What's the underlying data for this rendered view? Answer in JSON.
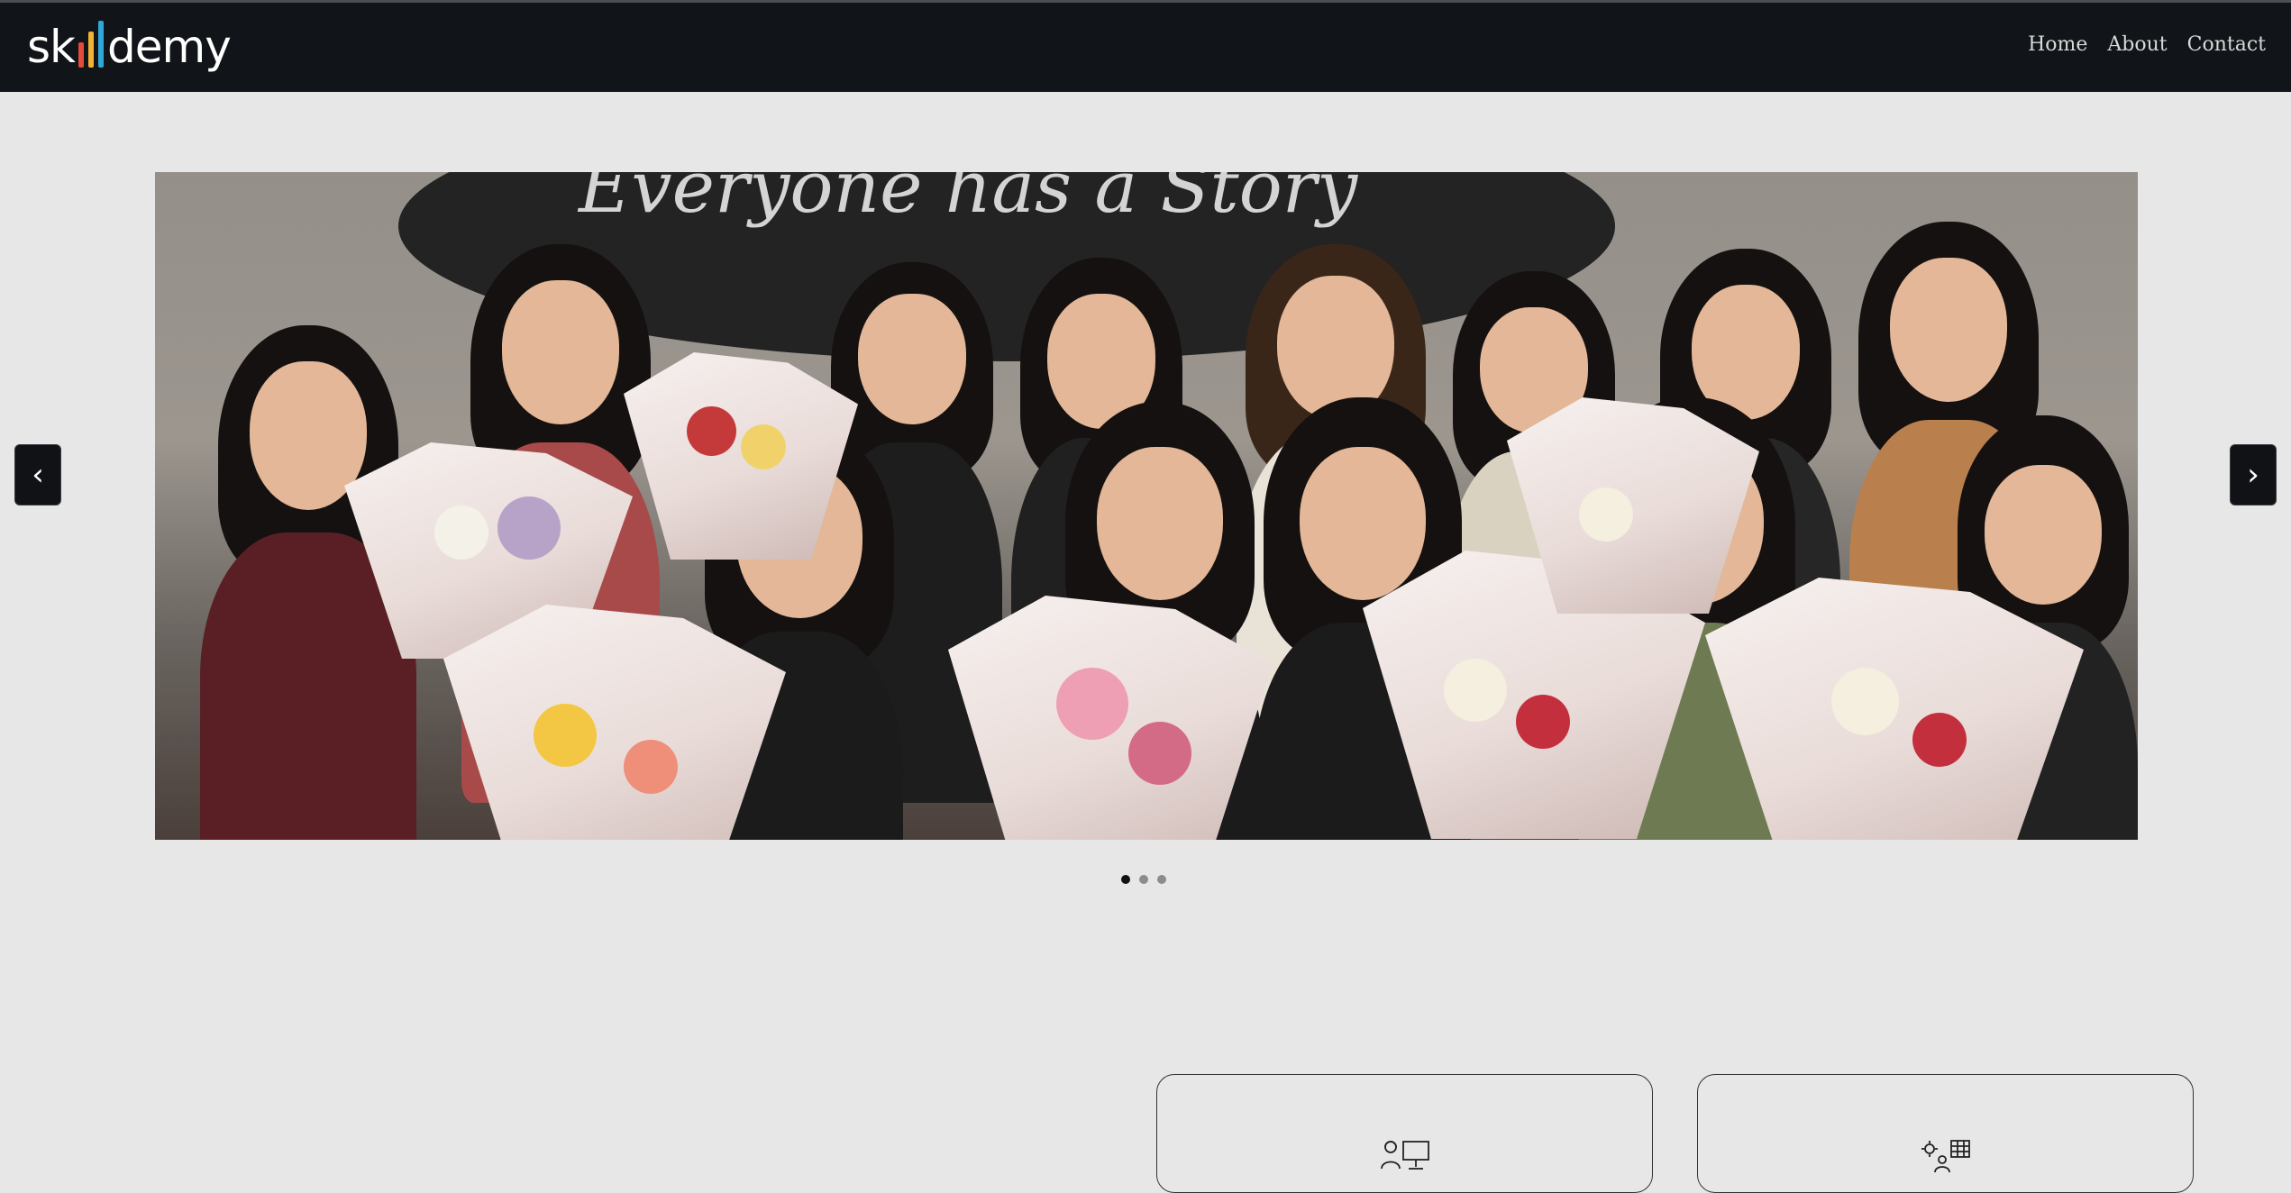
{
  "brand": {
    "name_prefix": "sk",
    "name_suffix": "demy",
    "logo_bar_colors": [
      "#e34b3c",
      "#f2b233",
      "#2fa8d9"
    ]
  },
  "nav": {
    "links": [
      {
        "label": "Home"
      },
      {
        "label": "About"
      },
      {
        "label": "Contact"
      }
    ]
  },
  "carousel": {
    "prev_label": "‹",
    "next_label": "›",
    "slide_count": 3,
    "active_index": 0,
    "slide_text": "Everyone has a Story"
  },
  "features": [
    {
      "icon": "support-presentation-icon"
    },
    {
      "icon": "settings-grid-icon"
    }
  ],
  "colors": {
    "navbar": "#111418",
    "page_bg": "#e7e7e7"
  }
}
